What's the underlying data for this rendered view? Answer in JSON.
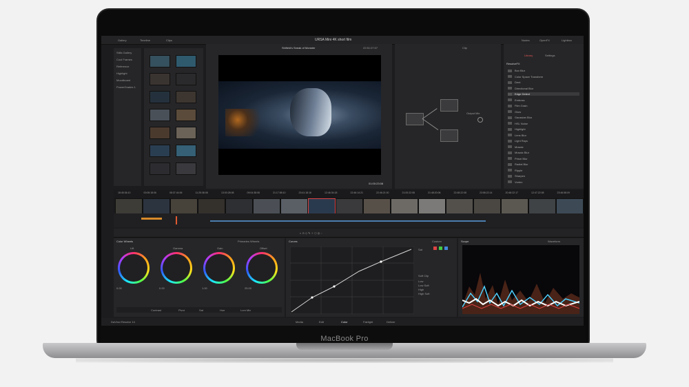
{
  "device": {
    "label": "MacBook Pro"
  },
  "app": {
    "project_title": "URSA Mini 4K short film",
    "top_left": {
      "gallery": "Gallery",
      "timeline": "Timeline",
      "clips": "Clips"
    },
    "top_right": {
      "nodes": "Nodes",
      "openfx": "OpenFX",
      "lightbox": "Lightbox"
    },
    "viewer": {
      "clip_name": "Shifield's Sneak of Monster",
      "timecode_top": "22:51:07:07",
      "timecode": "01:00:23:08"
    },
    "sidebar": [
      "Stills Gallery",
      "Cool Frames",
      "Reference",
      "Highlight",
      "Moodboard",
      "PowerGrades 1"
    ],
    "node_editor": {
      "clip_label": "Clip",
      "output_label": "Output Mix"
    },
    "fx": {
      "title": "ResolveFX",
      "tabs": [
        "Library",
        "Settings"
      ],
      "items": [
        "Box Blur",
        "Color Space Transform",
        "Dent",
        "Directional Blur",
        "Edge Detect",
        "Emboss",
        "Film Grain",
        "Glow",
        "Gaussian Blur",
        "HSL Noise",
        "Highlight",
        "Lens Blur",
        "Light Rays",
        "Mosaic",
        "Mosaic Blur",
        "Prism Blur",
        "Radial Blur",
        "Ripple",
        "Sharpen",
        "Vortex"
      ],
      "selected": "Edge Detect"
    },
    "timeline_timecodes": [
      "18:45:36:10",
      "00:05:18:06",
      "08:37:44:06",
      "11:25:38:08",
      "13:00:28:08",
      "09:04:38:08",
      "21:17:58:10",
      "23:41:18:16",
      "12:46:34:18",
      "22:46:14:21",
      "22:46:21:00",
      "21:00:22:08",
      "21:48:20:06",
      "22:48:22:08",
      "23:58:22:14",
      "20:48:22:17",
      "12:47:22:08",
      "23:46:58:09"
    ],
    "color_wheels": {
      "title": "Color Wheels",
      "mode": "Primaries Wheels",
      "wheels": [
        {
          "name": "Lift",
          "values": [
            "0.00",
            "0.00",
            "0.00",
            "0.00"
          ]
        },
        {
          "name": "Gamma",
          "values": [
            "0.00",
            "0.00",
            "0.00",
            "0.00"
          ]
        },
        {
          "name": "Gain",
          "values": [
            "1.00",
            "1.00",
            "1.00",
            "1.00"
          ]
        },
        {
          "name": "Offset",
          "values": [
            "25.00",
            "25.00",
            "25.00",
            "25.00"
          ]
        }
      ],
      "footer": [
        "Contrast",
        "Pivot",
        "Sat",
        "Hue",
        "Lum Mix"
      ]
    },
    "curves": {
      "title": "Curves",
      "mode": "Custom",
      "sat_label": "Sat",
      "soft_clip": [
        "Soft Clip",
        "Low",
        "Low Soft",
        "High",
        "High Soft"
      ]
    },
    "scope": {
      "title": "Scope",
      "mode": "Waveform"
    },
    "status": {
      "app_name": "DaVinci Resolve 14"
    },
    "pages": [
      "Media",
      "Edit",
      "Color",
      "Fairlight",
      "Deliver"
    ],
    "active_page": "Color"
  }
}
